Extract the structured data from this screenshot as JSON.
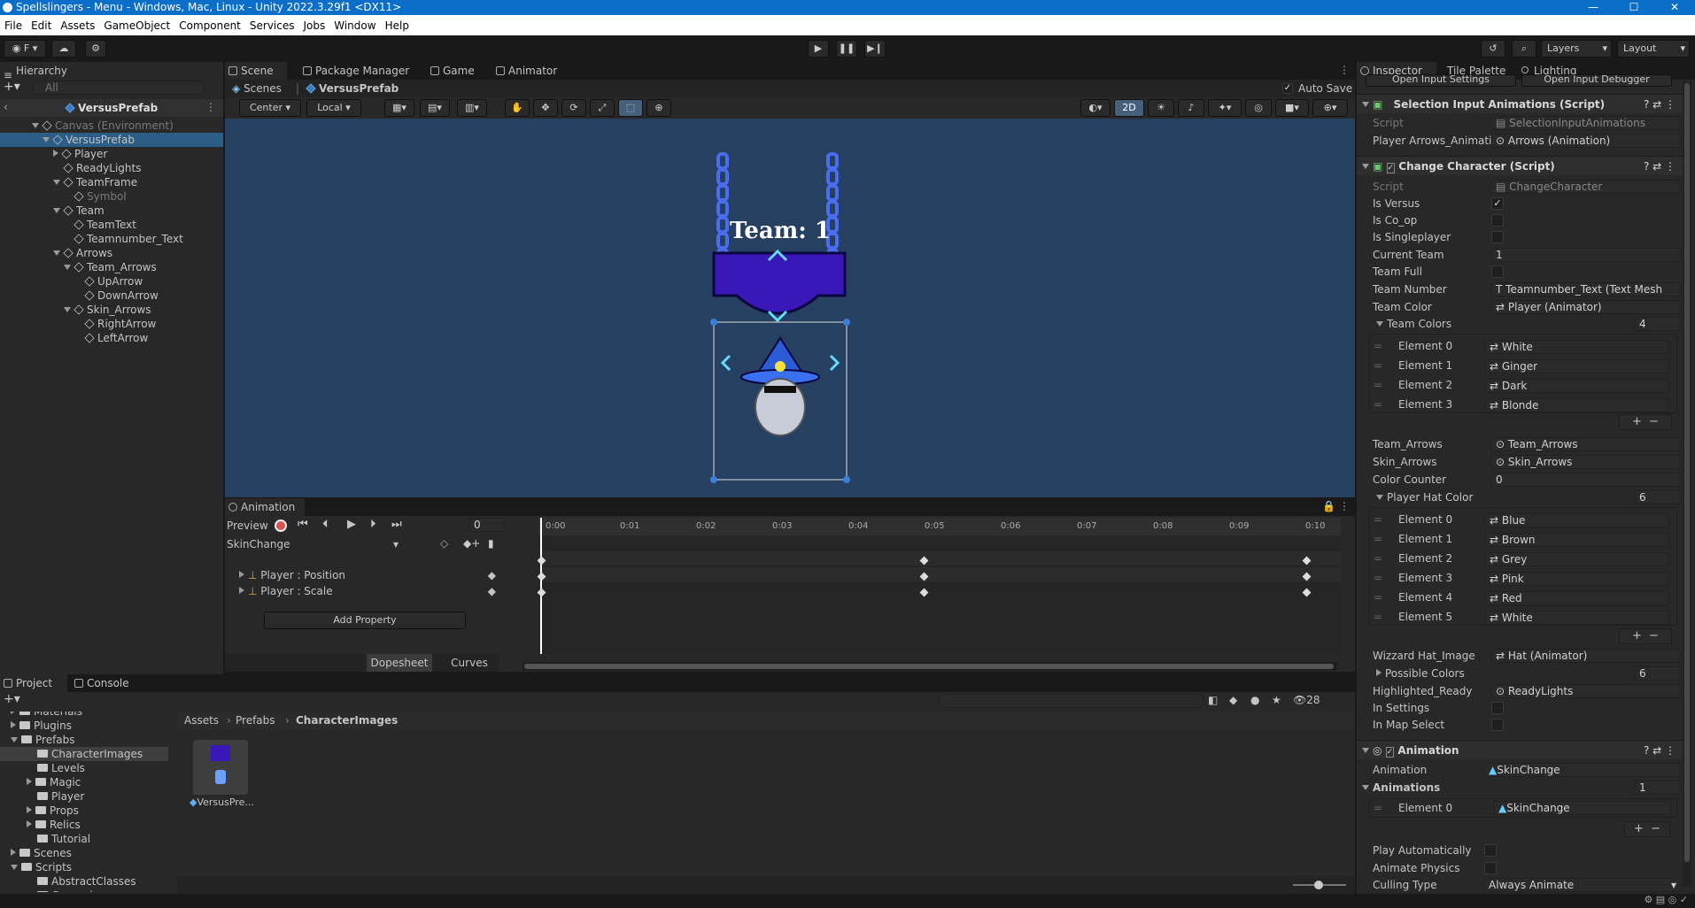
{
  "window": {
    "title": "Spellslingers - Menu - Windows, Mac, Linux - Unity 2022.3.29f1 <DX11>",
    "controls": [
      "—",
      "☐",
      "✕"
    ]
  },
  "menu": [
    "File",
    "Edit",
    "Assets",
    "GameObject",
    "Component",
    "Services",
    "Jobs",
    "Window",
    "Help"
  ],
  "toolbar": {
    "account": "F",
    "layers": "Layers",
    "layout": "Layout"
  },
  "hierarchy": {
    "tab": "Hierarchy",
    "search_placeholder": "All",
    "root": "VersusPrefab",
    "rows": [
      {
        "label": "Canvas (Environment)",
        "indent": 0,
        "state": "open",
        "dim": true
      },
      {
        "label": "VersusPrefab",
        "indent": 1,
        "state": "open",
        "sel": true
      },
      {
        "label": "Player",
        "indent": 2,
        "state": "closed"
      },
      {
        "label": "ReadyLights",
        "indent": 2,
        "state": "none"
      },
      {
        "label": "TeamFrame",
        "indent": 2,
        "state": "open"
      },
      {
        "label": "Symbol",
        "indent": 3,
        "state": "none",
        "dim": true
      },
      {
        "label": "Team",
        "indent": 2,
        "state": "open"
      },
      {
        "label": "TeamText",
        "indent": 3,
        "state": "none"
      },
      {
        "label": "Teamnumber_Text",
        "indent": 3,
        "state": "none"
      },
      {
        "label": "Arrows",
        "indent": 2,
        "state": "open"
      },
      {
        "label": "Team_Arrows",
        "indent": 3,
        "state": "open"
      },
      {
        "label": "UpArrow",
        "indent": 4,
        "state": "none"
      },
      {
        "label": "DownArrow",
        "indent": 4,
        "state": "none"
      },
      {
        "label": "Skin_Arrows",
        "indent": 3,
        "state": "open"
      },
      {
        "label": "RightArrow",
        "indent": 4,
        "state": "none"
      },
      {
        "label": "LeftArrow",
        "indent": 4,
        "state": "none"
      }
    ]
  },
  "scene_tabs": [
    "Scene",
    "Package Manager",
    "Game",
    "Animator"
  ],
  "breadcrumb": {
    "scenes": "Scenes",
    "prefab": "VersusPrefab",
    "autosave": "Auto Save"
  },
  "scene_tools": {
    "pivot": "Center",
    "space": "Local",
    "mode2d": "2D"
  },
  "scene_content": {
    "team_label": "Team: 1"
  },
  "animation": {
    "tab": "Animation",
    "preview": "Preview",
    "frame": "0",
    "clip": "SkinChange",
    "properties": [
      "Player : Position",
      "Player : Scale"
    ],
    "add_property": "Add Property",
    "footer_tabs": [
      "Dopesheet",
      "Curves"
    ],
    "ruler": [
      "0:00",
      "0:01",
      "0:02",
      "0:03",
      "0:04",
      "0:05",
      "0:06",
      "0:07",
      "0:08",
      "0:09",
      "0:10"
    ]
  },
  "project": {
    "tabs": [
      "Project",
      "Console"
    ],
    "count": "28",
    "breadcrumb": [
      "Assets",
      "Prefabs",
      "CharacterImages"
    ],
    "tree": [
      {
        "label": "Materials",
        "indent": 0,
        "state": "closed"
      },
      {
        "label": "Plugins",
        "indent": 0,
        "state": "closed"
      },
      {
        "label": "Prefabs",
        "indent": 0,
        "state": "open"
      },
      {
        "label": "CharacterImages",
        "indent": 1,
        "state": "none",
        "sel": true
      },
      {
        "label": "Levels",
        "indent": 1,
        "state": "none"
      },
      {
        "label": "Magic",
        "indent": 1,
        "state": "closed"
      },
      {
        "label": "Player",
        "indent": 1,
        "state": "none"
      },
      {
        "label": "Props",
        "indent": 1,
        "state": "closed"
      },
      {
        "label": "Relics",
        "indent": 1,
        "state": "closed"
      },
      {
        "label": "Tutorial",
        "indent": 1,
        "state": "none"
      },
      {
        "label": "Scenes",
        "indent": 0,
        "state": "closed"
      },
      {
        "label": "Scripts",
        "indent": 0,
        "state": "open"
      },
      {
        "label": "AbstractClasses",
        "indent": 1,
        "state": "none"
      },
      {
        "label": "Gameplay",
        "indent": 1,
        "state": "none"
      }
    ],
    "asset": "VersusPre..."
  },
  "inspector": {
    "tabs": [
      "Inspector",
      "Tile Palette",
      "Lighting"
    ],
    "top_buttons": [
      "Open Input Settings",
      "Open Input Debugger"
    ],
    "sel_anim": {
      "title": "Selection Input Animations (Script)",
      "script_label": "Script",
      "script": "SelectionInputAnimations",
      "arrows_label": "Player Arrows_Animatio",
      "arrows": "Arrows (Animation)"
    },
    "change_char": {
      "title": "Change Character (Script)",
      "script_label": "Script",
      "script": "ChangeCharacter",
      "is_versus": "Is Versus",
      "is_coop": "Is Co_op",
      "is_single": "Is Singleplayer",
      "current_team_label": "Current Team",
      "current_team": "1",
      "team_full": "Team Full",
      "team_number_label": "Team Number",
      "team_number": "Teamnumber_Text (Text Mesh",
      "team_color_label": "Team Color",
      "team_color": "Player (Animator)",
      "team_colors_label": "Team Colors",
      "team_colors_count": "4",
      "team_colors": [
        {
          "k": "Element 0",
          "v": "White"
        },
        {
          "k": "Element 1",
          "v": "Ginger"
        },
        {
          "k": "Element 2",
          "v": "Dark"
        },
        {
          "k": "Element 3",
          "v": "Blonde"
        }
      ],
      "team_arrows_label": "Team_Arrows",
      "team_arrows": "Team_Arrows",
      "skin_arrows_label": "Skin_Arrows",
      "skin_arrows": "Skin_Arrows",
      "color_counter_label": "Color Counter",
      "color_counter": "0",
      "hat_label": "Player Hat Color",
      "hat_count": "6",
      "hat_colors": [
        {
          "k": "Element 0",
          "v": "Blue"
        },
        {
          "k": "Element 1",
          "v": "Brown"
        },
        {
          "k": "Element 2",
          "v": "Grey"
        },
        {
          "k": "Element 3",
          "v": "Pink"
        },
        {
          "k": "Element 4",
          "v": "Red"
        },
        {
          "k": "Element 5",
          "v": "White"
        }
      ],
      "wizard_label": "Wizzard Hat_Image",
      "wizard": "Hat (Animator)",
      "possible_label": "Possible Colors",
      "possible_count": "6",
      "highlight_label": "Highlighted_Ready",
      "highlight": "ReadyLights",
      "in_settings": "In Settings",
      "in_map": "In Map Select"
    },
    "animation_comp": {
      "title": "Animation",
      "anim_label": "Animation",
      "anim": "SkinChange",
      "anims_label": "Animations",
      "anims_count": "1",
      "elem_label": "Element 0",
      "elem": "SkinChange",
      "play_auto": "Play Automatically",
      "physics": "Animate Physics",
      "culling_label": "Culling Type",
      "culling": "Always Animate"
    }
  },
  "colors": {
    "accent": "#0b6ec9",
    "scene_bg": "#254061",
    "selection": "#2c5d87",
    "sign": "#3a18b8"
  }
}
